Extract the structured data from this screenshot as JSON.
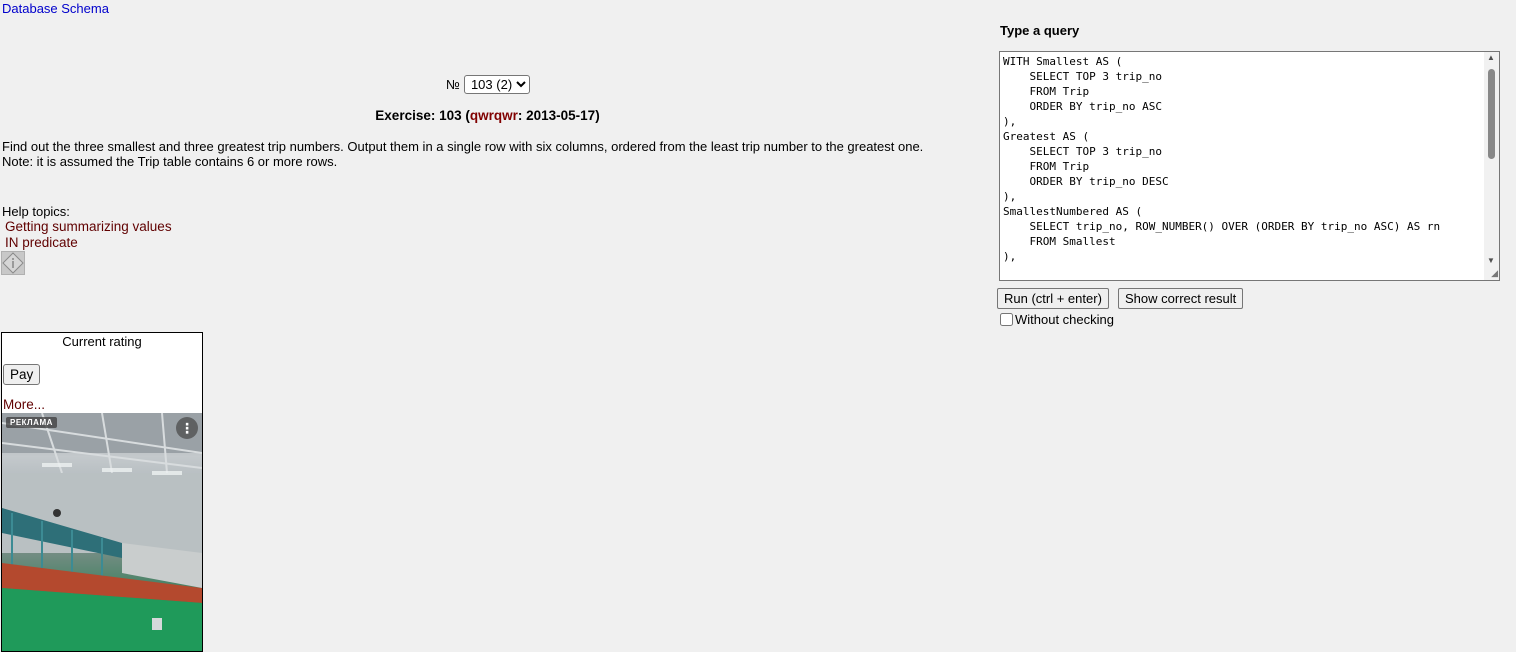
{
  "top": {
    "schema_link": "Database Schema"
  },
  "exercise": {
    "number_label": "№",
    "selected": "103 (2)",
    "title_prefix": "Exercise: 103 (",
    "author": "qwrqwr",
    "title_suffix": ": 2013-05-17)",
    "description": "Find out the three smallest and three greatest trip numbers. Output them in a single row with six columns, ordered from the least trip number to the greatest one.",
    "note": "Note: it is assumed the Trip table contains 6 or more rows."
  },
  "help": {
    "title": "Help topics:",
    "topics": [
      "Getting summarizing values",
      "IN predicate"
    ],
    "info_icon": "diamond-info-icon"
  },
  "rating": {
    "title": "Current rating",
    "pay_label": "Pay",
    "more_label": "More...",
    "ad_badge": "РЕКЛАМА",
    "ad_menu_icon": "kebab-menu-icon"
  },
  "query": {
    "label": "Type a query",
    "text": "WITH Smallest AS (\n    SELECT TOP 3 trip_no\n    FROM Trip\n    ORDER BY trip_no ASC\n),\nGreatest AS (\n    SELECT TOP 3 trip_no\n    FROM Trip\n    ORDER BY trip_no DESC\n),\nSmallestNumbered AS (\n    SELECT trip_no, ROW_NUMBER() OVER (ORDER BY trip_no ASC) AS rn\n    FROM Smallest\n),",
    "run_label": "Run (ctrl + enter)",
    "show_result_label": "Show correct result",
    "without_checking_label": "Without checking"
  },
  "colors": {
    "link_blue": "#0000cc",
    "link_dark_red": "#600000",
    "author_red": "#800000",
    "background": "#f0f0f0"
  }
}
